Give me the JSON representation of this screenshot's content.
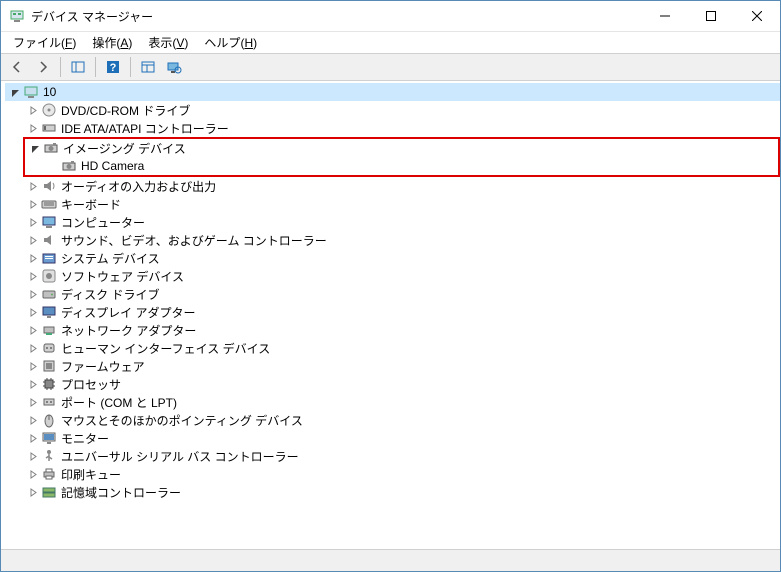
{
  "window": {
    "title": "デバイス マネージャー"
  },
  "menu": {
    "file": {
      "label": "ファイル",
      "mnemonic": "F"
    },
    "action": {
      "label": "操作",
      "mnemonic": "A"
    },
    "view": {
      "label": "表示",
      "mnemonic": "V"
    },
    "help": {
      "label": "ヘルプ",
      "mnemonic": "H"
    }
  },
  "tree": {
    "root": {
      "label": "10"
    },
    "items": [
      {
        "label": "DVD/CD-ROM ドライブ",
        "icon": "disc"
      },
      {
        "label": "IDE ATA/ATAPI コントローラー",
        "icon": "ide"
      },
      {
        "label": "イメージング デバイス",
        "icon": "camera",
        "expanded": true,
        "highlighted": true,
        "children": [
          {
            "label": "HD Camera",
            "icon": "camera"
          }
        ]
      },
      {
        "label": "オーディオの入力および出力",
        "icon": "audio"
      },
      {
        "label": "キーボード",
        "icon": "keyboard"
      },
      {
        "label": "コンピューター",
        "icon": "computer"
      },
      {
        "label": "サウンド、ビデオ、およびゲーム コントローラー",
        "icon": "sound"
      },
      {
        "label": "システム デバイス",
        "icon": "system"
      },
      {
        "label": "ソフトウェア デバイス",
        "icon": "software"
      },
      {
        "label": "ディスク ドライブ",
        "icon": "disk"
      },
      {
        "label": "ディスプレイ アダプター",
        "icon": "display"
      },
      {
        "label": "ネットワーク アダプター",
        "icon": "network"
      },
      {
        "label": "ヒューマン インターフェイス デバイス",
        "icon": "hid"
      },
      {
        "label": "ファームウェア",
        "icon": "firmware"
      },
      {
        "label": "プロセッサ",
        "icon": "cpu"
      },
      {
        "label": "ポート (COM と LPT)",
        "icon": "port"
      },
      {
        "label": "マウスとそのほかのポインティング デバイス",
        "icon": "mouse"
      },
      {
        "label": "モニター",
        "icon": "monitor"
      },
      {
        "label": "ユニバーサル シリアル バス コントローラー",
        "icon": "usb"
      },
      {
        "label": "印刷キュー",
        "icon": "printer"
      },
      {
        "label": "記憶域コントローラー",
        "icon": "storage"
      }
    ]
  }
}
